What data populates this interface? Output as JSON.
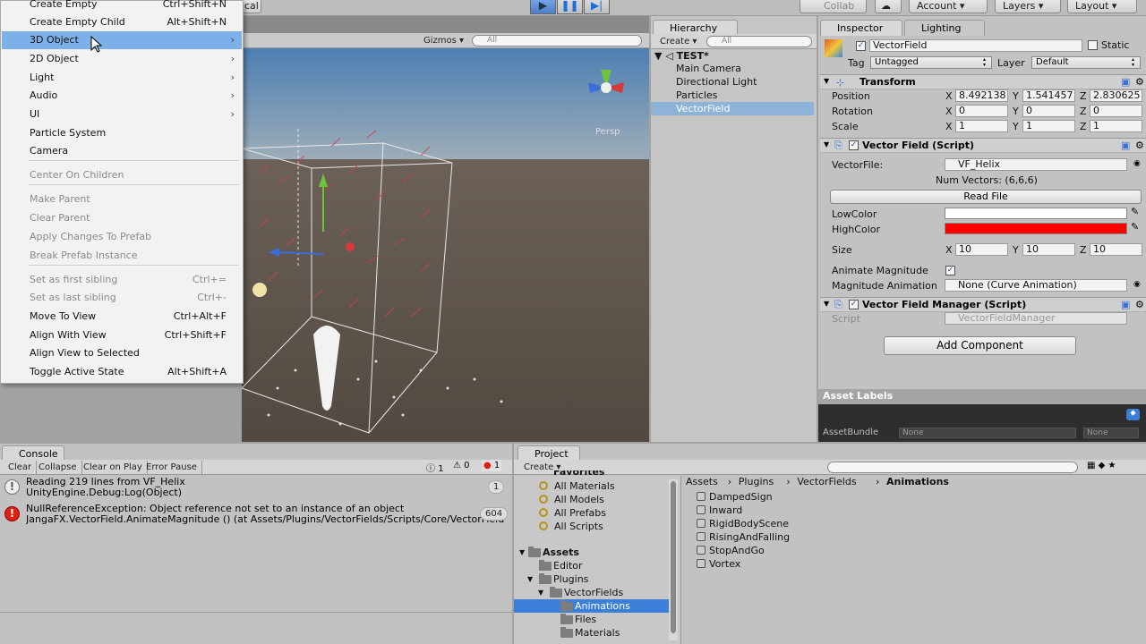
{
  "toolbar": {
    "partial_label": "cal",
    "collab": "Collab",
    "account": "Account",
    "layers": "Layers",
    "layout": "Layout",
    "play_icon": "play-icon",
    "pause_icon": "pause-icon",
    "step_icon": "step-icon",
    "cloud_icon": "cloud-icon"
  },
  "context_menu": {
    "items": [
      {
        "label": "Create Empty",
        "shortcut": "Ctrl+Shift+N",
        "enabled": true
      },
      {
        "label": "Create Empty Child",
        "shortcut": "Alt+Shift+N",
        "enabled": true
      },
      {
        "label": "3D Object",
        "shortcut": "",
        "submenu": true,
        "enabled": true,
        "selected": true
      },
      {
        "label": "2D Object",
        "shortcut": "",
        "submenu": true,
        "enabled": true
      },
      {
        "label": "Light",
        "shortcut": "",
        "submenu": true,
        "enabled": true
      },
      {
        "label": "Audio",
        "shortcut": "",
        "submenu": true,
        "enabled": true
      },
      {
        "label": "UI",
        "shortcut": "",
        "submenu": true,
        "enabled": true
      },
      {
        "label": "Particle System",
        "shortcut": "",
        "enabled": true
      },
      {
        "label": "Camera",
        "shortcut": "",
        "enabled": true
      },
      {
        "label": "Center On Children",
        "shortcut": "",
        "enabled": false
      },
      {
        "label": "Make Parent",
        "shortcut": "",
        "enabled": false
      },
      {
        "label": "Clear Parent",
        "shortcut": "",
        "enabled": false
      },
      {
        "label": "Apply Changes To Prefab",
        "shortcut": "",
        "enabled": false
      },
      {
        "label": "Break Prefab Instance",
        "shortcut": "",
        "enabled": false
      },
      {
        "label": "Set as first sibling",
        "shortcut": "Ctrl+=",
        "enabled": false
      },
      {
        "label": "Set as last sibling",
        "shortcut": "Ctrl+-",
        "enabled": false
      },
      {
        "label": "Move To View",
        "shortcut": "Ctrl+Alt+F",
        "enabled": true
      },
      {
        "label": "Align With View",
        "shortcut": "Ctrl+Shift+F",
        "enabled": true
      },
      {
        "label": "Align View to Selected",
        "shortcut": "",
        "enabled": true
      },
      {
        "label": "Toggle Active State",
        "shortcut": "Alt+Shift+A",
        "enabled": true
      }
    ]
  },
  "scene": {
    "gizmos": "Gizmos",
    "search_placeholder": "All",
    "persp": "Persp"
  },
  "hierarchy": {
    "tab": "Hierarchy",
    "create": "Create",
    "search_placeholder": "All",
    "scene_name": "TEST*",
    "items": [
      "Main Camera",
      "Directional Light",
      "Particles",
      "VectorField"
    ],
    "selected_index": 3
  },
  "inspector": {
    "tab": "Inspector",
    "tab2": "Lighting",
    "object_name": "VectorField",
    "static_label": "Static",
    "tag_label": "Tag",
    "tag_value": "Untagged",
    "layer_label": "Layer",
    "layer_value": "Default",
    "transform": {
      "title": "Transform",
      "position_label": "Position",
      "rotation_label": "Rotation",
      "scale_label": "Scale",
      "position": {
        "x": "8.492138",
        "y": "1.541457",
        "z": "2.830625"
      },
      "rotation": {
        "x": "0",
        "y": "0",
        "z": "0"
      },
      "scale": {
        "x": "1",
        "y": "1",
        "z": "1"
      }
    },
    "vector_field": {
      "title": "Vector Field (Script)",
      "vectorfile_label": "VectorFile:",
      "vectorfile_value": "VF_Helix",
      "num_vectors": "Num Vectors: (6,6,6)",
      "read_file": "Read File",
      "lowcolor_label": "LowColor",
      "lowcolor": "#ffffff",
      "highcolor_label": "HighColor",
      "highcolor": "#ff0000",
      "size_label": "Size",
      "size": {
        "x": "10",
        "y": "10",
        "z": "10"
      },
      "animate_magnitude_label": "Animate Magnitude",
      "magnitude_animation_label": "Magnitude Animation",
      "magnitude_animation_value": "None (Curve Animation)"
    },
    "manager": {
      "title": "Vector Field Manager (Script)",
      "script_label": "Script",
      "script_value": "VectorFieldManager"
    },
    "add_component": "Add Component",
    "asset_labels": "Asset Labels",
    "assetbundle_label": "AssetBundle",
    "assetbundle_value": "None",
    "assetbundle_variant": "None",
    "axis_x": "X",
    "axis_y": "Y",
    "axis_z": "Z"
  },
  "console": {
    "tab": "Console",
    "buttons": [
      "Clear",
      "Collapse",
      "Clear on Play",
      "Error Pause"
    ],
    "log_count": "1",
    "warn_count": "0",
    "error_count": "1",
    "entries": [
      {
        "type": "log",
        "line1": "Reading 219 lines from VF_Helix",
        "line2": "UnityEngine.Debug:Log(Object)",
        "count": "1"
      },
      {
        "type": "error",
        "line1": "NullReferenceException: Object reference not set to an instance of an object",
        "line2": "JangaFX.VectorField.AnimateMagnitude () (at Assets/Plugins/VectorFields/Scripts/Core/VectorFields",
        "count": "604"
      }
    ]
  },
  "project": {
    "tab": "Project",
    "create": "Create",
    "favorites_partial": "Favorites",
    "favorites": [
      "All Materials",
      "All Models",
      "All Prefabs",
      "All Scripts"
    ],
    "assets_root": "Assets",
    "tree": [
      {
        "label": "Editor",
        "depth": 1
      },
      {
        "label": "Plugins",
        "depth": 1
      },
      {
        "label": "VectorFields",
        "depth": 2
      },
      {
        "label": "Animations",
        "depth": 3,
        "selected": true
      },
      {
        "label": "Files",
        "depth": 3
      },
      {
        "label": "Materials",
        "depth": 3
      }
    ],
    "breadcrumb": [
      "Assets",
      "Plugins",
      "VectorFields",
      "Animations"
    ],
    "files": [
      "DampedSign",
      "Inward",
      "RigidBodyScene",
      "RisingAndFalling",
      "StopAndGo",
      "Vortex"
    ]
  },
  "colors": {
    "selection": "#7cb0e8",
    "hierarchy_selection": "#8eb3d8",
    "accent_blue": "#3b7fd9"
  }
}
